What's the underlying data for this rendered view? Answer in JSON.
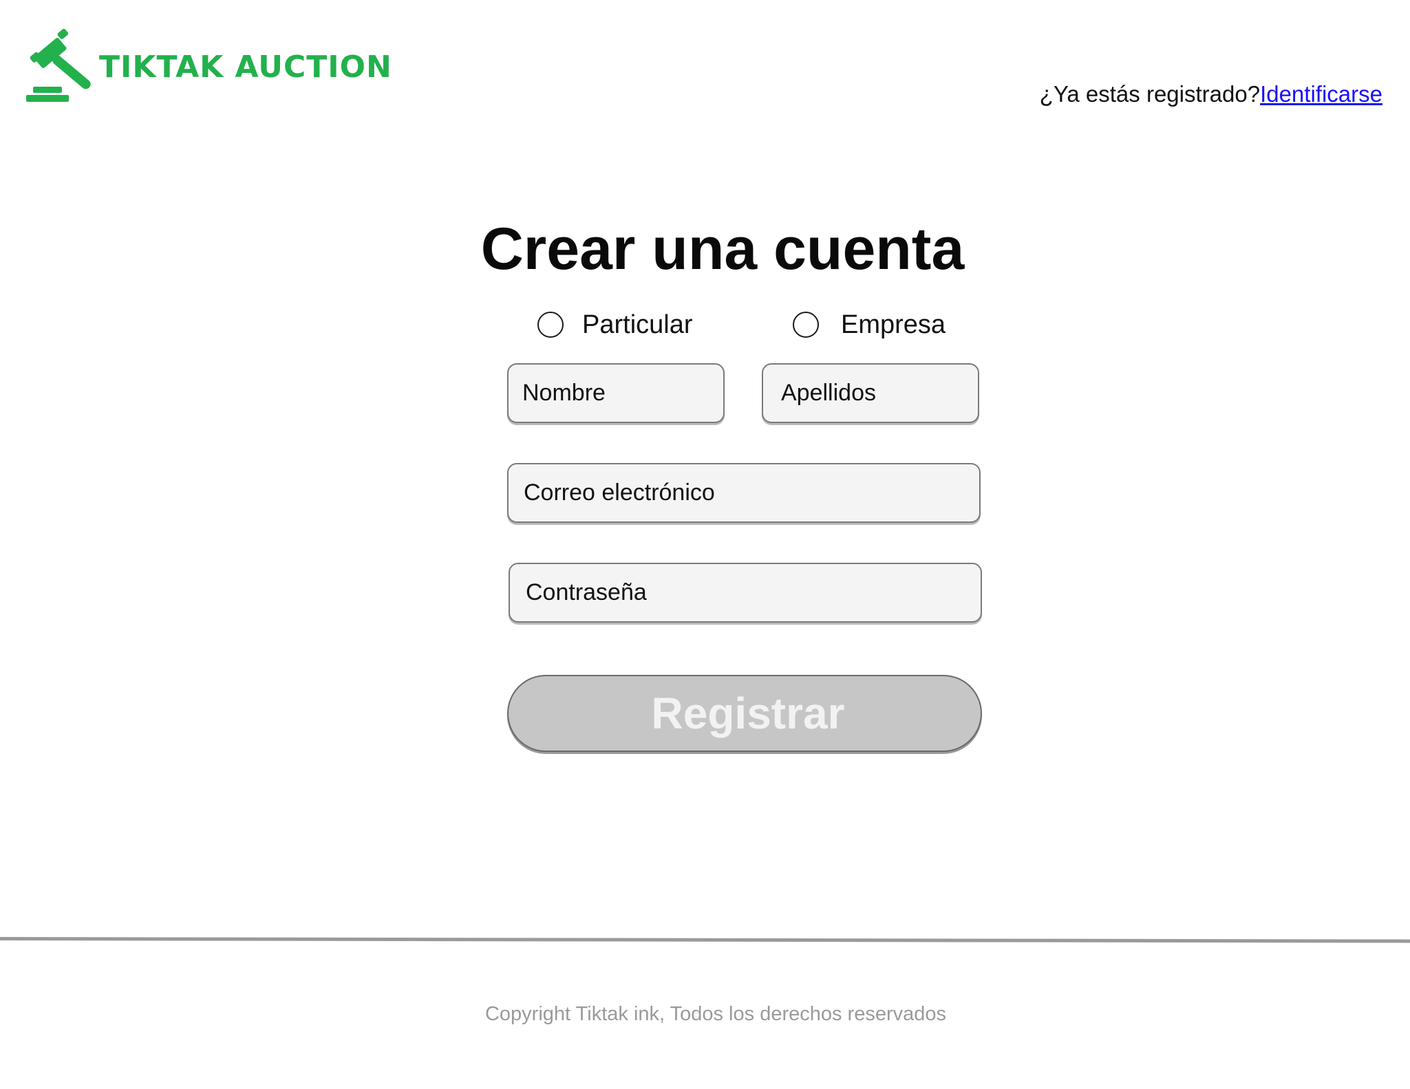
{
  "brand": {
    "name": "TIKTAK AUCTION",
    "color": "#22b14c",
    "icon": "gavel-icon"
  },
  "header": {
    "signin_prompt": "¿Ya estás registrado?",
    "signin_link": "Identificarse"
  },
  "form": {
    "title": "Crear una cuenta",
    "account_types": [
      {
        "label": "Particular",
        "selected": false
      },
      {
        "label": "Empresa",
        "selected": false
      }
    ],
    "fields": {
      "first_name_placeholder": "Nombre",
      "last_name_placeholder": "Apellidos",
      "email_placeholder": "Correo electrónico",
      "password_placeholder": "Contraseña"
    },
    "submit_label": "Registrar",
    "submit_enabled": false
  },
  "footer": {
    "copyright": "Copyright Tiktak ink, Todos los derechos reservados"
  },
  "colors": {
    "link": "#1a0dff",
    "button_disabled_bg": "#c6c6c6",
    "footer_text": "#9a9a9a"
  }
}
